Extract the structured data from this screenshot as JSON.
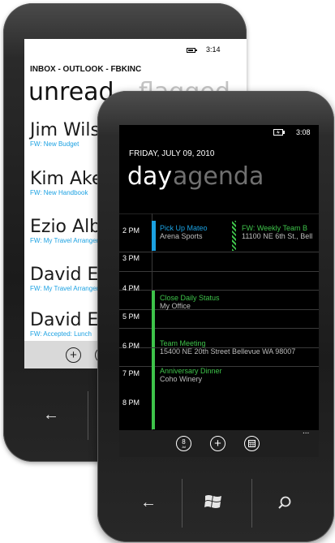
{
  "back_phone": {
    "status": {
      "time": "3:14"
    },
    "header": {
      "breadcrumb": "INBOX - OUTLOOK - FBKINC"
    },
    "tabs": [
      {
        "label": "unread"
      },
      {
        "label": "flagged"
      }
    ],
    "messages": [
      {
        "sender": "Jim Wilson",
        "subject": "FW: New Budget"
      },
      {
        "sender": "Kim Akers",
        "subject": "FW: New Handbook"
      },
      {
        "sender": "Ezio Alboglu",
        "subject": "FW: My Travel Arrangements"
      },
      {
        "sender": "David E.",
        "subject": "FW: My Travel Arrangements"
      },
      {
        "sender": "David E.",
        "subject": "FW: Accepted: Lunch"
      }
    ]
  },
  "front_phone": {
    "status": {
      "time": "3:08"
    },
    "header": {
      "date": "FRIDAY, JULY 09, 2010"
    },
    "tabs": [
      {
        "label": "day"
      },
      {
        "label": "agenda"
      }
    ],
    "hours": [
      "2 PM",
      "3 PM",
      "4 PM",
      "5 PM",
      "6 PM",
      "7 PM",
      "8 PM"
    ],
    "events": [
      {
        "title": "Pick Up Mateo",
        "location": "Arena Sports"
      },
      {
        "title": "FW: Weekly Team B",
        "location": "11100 NE 6th St., Bell"
      },
      {
        "title": "Close Daily Status",
        "location": "My Office"
      },
      {
        "title": "Team Meeting",
        "location": "15400 NE 20th Street Bellevue WA 98007"
      },
      {
        "title": "Anniversary Dinner",
        "location": "Coho Winery"
      }
    ],
    "app_bar": {
      "today_day": "8",
      "today_month": "Jul",
      "more": "..."
    }
  },
  "colors": {
    "accent_blue": "#1ba1e2",
    "accent_green": "#3ec34a"
  },
  "icons": [
    "back-arrow-icon",
    "windows-logo-icon",
    "search-icon",
    "add-icon",
    "calendar-icon",
    "today-icon",
    "battery-icon",
    "charging-icon"
  ]
}
